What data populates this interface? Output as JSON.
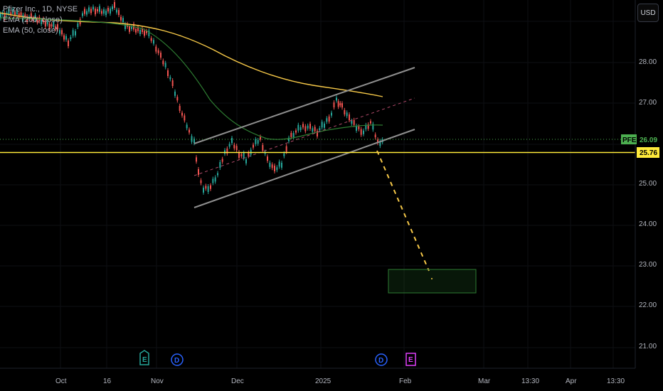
{
  "legend": {
    "symbol_line": "Pfizer Inc., 1D, NYSE",
    "ema200": "EMA (200, close)",
    "ema50": "EMA (50, close)"
  },
  "currency_button": "USD",
  "price_axis": {
    "ticks": [
      "28.00",
      "27.00",
      "25.00",
      "24.00",
      "23.00",
      "22.00",
      "21.00"
    ],
    "last_price": {
      "label": "PFE",
      "value": "26.09",
      "color": "#4caf50"
    },
    "horizontal_level": {
      "value": "25.76",
      "color": "#ffeb3b"
    }
  },
  "time_axis": {
    "ticks": [
      "Oct",
      "16",
      "Nov",
      "Dec",
      "2025",
      "Feb",
      "Mar",
      "13:30",
      "Apr",
      "13:30"
    ]
  },
  "events": [
    {
      "letter": "E",
      "color": "#26a69a",
      "icon": "earnings-icon"
    },
    {
      "letter": "D",
      "color": "#2962ff",
      "icon": "dividend-icon"
    },
    {
      "letter": "D",
      "color": "#2962ff",
      "icon": "dividend-icon"
    },
    {
      "letter": "E",
      "color": "#e040fb",
      "icon": "earnings-icon"
    }
  ],
  "colors": {
    "up": "#26a69a",
    "down": "#ef5350",
    "ema200": "#f7c948",
    "ema50": "#2e7d32",
    "channel": "#9e9e9e",
    "projection": "#f7c948",
    "target_box": "#2e7d32"
  }
}
